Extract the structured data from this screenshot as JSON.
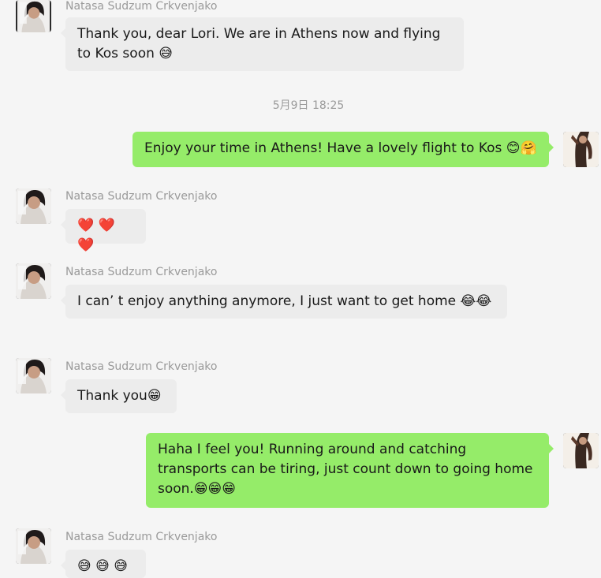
{
  "contact": {
    "name": "Natasa Sudzum Crkvenjako"
  },
  "timestamp": "5月9日 18:25",
  "messages": [
    {
      "direction": "in",
      "sender": "Natasa Sudzum Crkvenjako",
      "text": "Thank you, dear Lori. We are in Athens now and flying to Kos soon 😅"
    },
    {
      "direction": "out",
      "text": "Enjoy your time in Athens! Have a lovely flight to Kos 😊🤗"
    },
    {
      "direction": "in",
      "sender": "Natasa Sudzum Crkvenjako",
      "text": "❤️ ❤️ ❤️"
    },
    {
      "direction": "in",
      "sender": "Natasa Sudzum Crkvenjako",
      "text": "I can’ t enjoy anything anymore, I just want to get home 😂😂"
    },
    {
      "direction": "in",
      "sender": "Natasa Sudzum Crkvenjako",
      "text": "Thank you😁"
    },
    {
      "direction": "out",
      "text": "Haha I feel you! Running around and catching transports can be tiring, just count down to going home soon.😁😁😁"
    },
    {
      "direction": "in",
      "sender": "Natasa Sudzum Crkvenjako",
      "text": "😅 😅 😅"
    }
  ],
  "colors": {
    "incoming_bubble": "#ececec",
    "outgoing_bubble": "#95ec69",
    "background": "#f5f5f5",
    "meta_text": "#9a9a9a"
  }
}
